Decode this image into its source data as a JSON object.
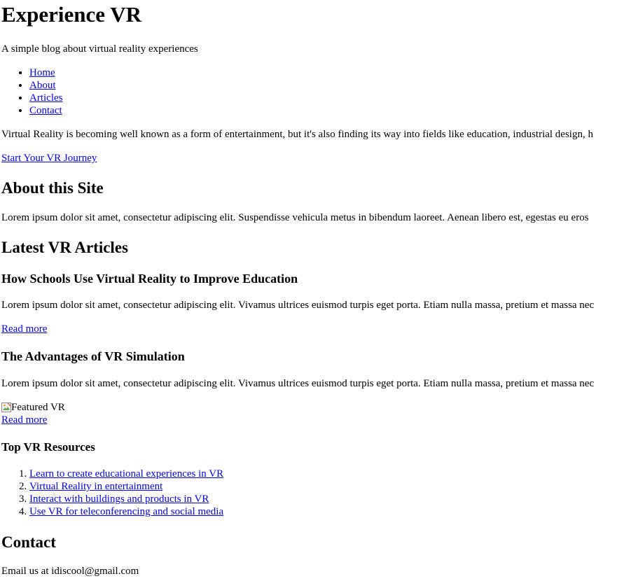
{
  "header": {
    "site_title": "Experience VR",
    "tagline": "A simple blog about virtual reality experiences"
  },
  "nav": {
    "items": [
      {
        "label": "Home"
      },
      {
        "label": "About"
      },
      {
        "label": "Articles"
      },
      {
        "label": "Contact"
      }
    ]
  },
  "intro": {
    "text": "Virtual Reality is becoming well known as a form of entertainment, but it's also finding its way into fields like education, industrial design, h",
    "cta_label": "Start Your VR Journey"
  },
  "about": {
    "heading": "About this Site",
    "text": "Lorem ipsum dolor sit amet, consectetur adipiscing elit. Suspendisse vehicula metus in bibendum laoreet. Aenean libero est, egestas eu eros"
  },
  "articles": {
    "heading": "Latest VR Articles",
    "items": [
      {
        "title": "How Schools Use Virtual Reality to Improve Education",
        "text": "Lorem ipsum dolor sit amet, consectetur adipiscing elit. Vivamus ultrices euismod turpis eget porta. Etiam nulla massa, pretium et massa nec",
        "read_more": "Read more"
      },
      {
        "title": "The Advantages of VR Simulation",
        "text": "Lorem ipsum dolor sit amet, consectetur adipiscing elit. Vivamus ultrices euismod turpis eget porta. Etiam nulla massa, pretium et massa nec",
        "image_alt": "Featured VR",
        "read_more": "Read more"
      }
    ]
  },
  "resources": {
    "heading": "Top VR Resources",
    "items": [
      {
        "label": "Learn to create educational experiences in VR"
      },
      {
        "label": "Virtual Reality in entertainment"
      },
      {
        "label": "Interact with buildings and products in VR"
      },
      {
        "label": "Use VR for teleconferencing and social media"
      }
    ]
  },
  "contact": {
    "heading": "Contact",
    "text": "Email us at idiscool@gmail.com"
  },
  "icons": {
    "broken_image": "broken-image-icon"
  }
}
